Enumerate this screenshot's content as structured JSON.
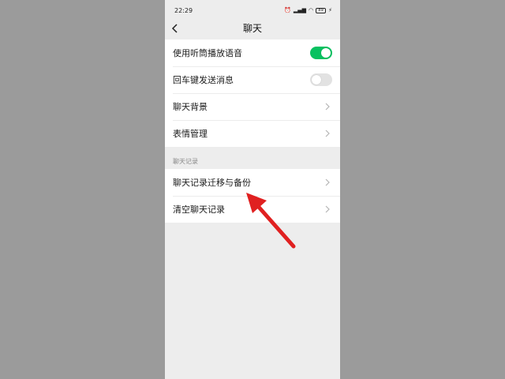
{
  "status_bar": {
    "time": "22:29",
    "icons": [
      "alarm-icon",
      "signal-icon",
      "wifi-icon",
      "battery-icon",
      "charging-icon"
    ],
    "battery_level": "89"
  },
  "header": {
    "title": "聊天",
    "back_icon": "chevron-left-icon"
  },
  "settings": [
    {
      "label": "使用听筒播放语音",
      "control": "toggle",
      "on": true
    },
    {
      "label": "回车键发送消息",
      "control": "toggle",
      "on": false
    },
    {
      "label": "聊天背景",
      "control": "chevron"
    },
    {
      "label": "表情管理",
      "control": "chevron"
    }
  ],
  "chat_records": {
    "section_label": "聊天记录",
    "items": [
      {
        "label": "聊天记录迁移与备份",
        "control": "chevron"
      },
      {
        "label": "清空聊天记录",
        "control": "chevron"
      }
    ]
  },
  "colors": {
    "toggle_on": "#07c160",
    "toggle_off": "#e2e2e2",
    "annotation_arrow": "#e02020",
    "page_background": "#ededed",
    "outer_background": "#9b9b9b"
  }
}
